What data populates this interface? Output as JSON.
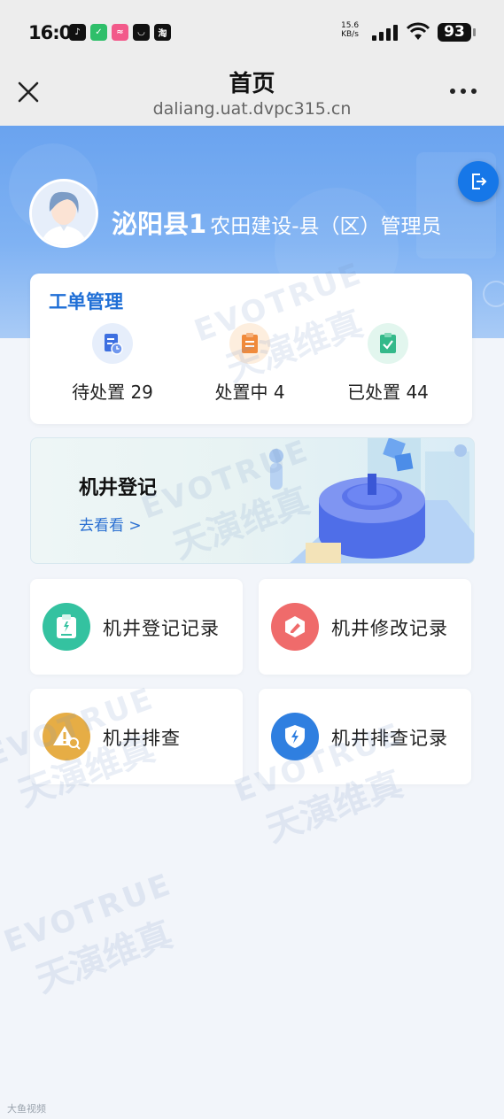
{
  "status_bar": {
    "time": "16:01",
    "net_speed_value": "15.6",
    "net_speed_unit": "KB/s",
    "battery": "93"
  },
  "nav": {
    "title": "首页",
    "url": "daliang.uat.dvpc315.cn"
  },
  "user": {
    "name": "泌阳县1",
    "role": "农田建设-县（区）管理员"
  },
  "work_orders": {
    "title": "工单管理",
    "items": [
      {
        "label": "待处置",
        "count": "29"
      },
      {
        "label": "处置中",
        "count": "4"
      },
      {
        "label": "已处置",
        "count": "44"
      }
    ]
  },
  "banner": {
    "title": "机井登记",
    "link": "去看看 >"
  },
  "menu": [
    {
      "label": "机井登记记录",
      "color": "#34c2a0"
    },
    {
      "label": "机井修改记录",
      "color": "#ef6b6b"
    },
    {
      "label": "机井排查",
      "color": "#e6ad45"
    },
    {
      "label": "机井排查记录",
      "color": "#2f7fe0"
    }
  ],
  "watermark": {
    "en": "EVOTRUE",
    "cn": "天演维真"
  },
  "footer_mark": "大鱼视频"
}
